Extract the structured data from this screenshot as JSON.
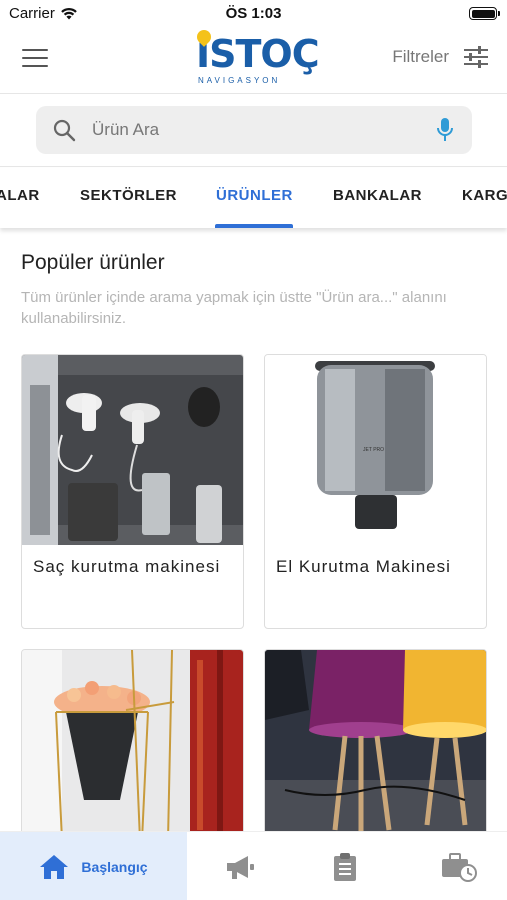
{
  "status_bar": {
    "carrier": "Carrier",
    "time": "ÖS 1:03"
  },
  "header": {
    "menu_icon": "hamburger-menu-icon",
    "logo_text": "İSTOÇ",
    "logo_subtext": "NAVIGASYON",
    "filter_label": "Filtreler",
    "filter_icon": "sliders-icon"
  },
  "search": {
    "placeholder": "Ürün Ara",
    "value": "",
    "search_icon": "search-icon",
    "mic_icon": "microphone-icon"
  },
  "tabs": [
    {
      "label": "ALAR"
    },
    {
      "label": "SEKTÖRLER"
    },
    {
      "label": "ÜRÜNLER",
      "active": true
    },
    {
      "label": "BANKALAR"
    },
    {
      "label": "KARG"
    }
  ],
  "section": {
    "title": "Popüler ürünler",
    "description": "Tüm ürünler içinde arama yapmak için üstte \"Ürün ara...\" alanını kullanabilirsiniz."
  },
  "products": [
    {
      "title": "Saç kurutma makinesi"
    },
    {
      "title": "El Kurutma Makinesi"
    },
    {
      "title": ""
    },
    {
      "title": ""
    }
  ],
  "bottom_nav": [
    {
      "label": "Başlangıç",
      "icon": "home-icon",
      "active": true
    },
    {
      "label": "",
      "icon": "megaphone-icon"
    },
    {
      "label": "",
      "icon": "clipboard-icon"
    },
    {
      "label": "",
      "icon": "briefcase-clock-icon"
    }
  ],
  "colors": {
    "accent": "#2f6fd6",
    "brand": "#1a5ea8",
    "logo_yellow": "#f4c21a"
  }
}
